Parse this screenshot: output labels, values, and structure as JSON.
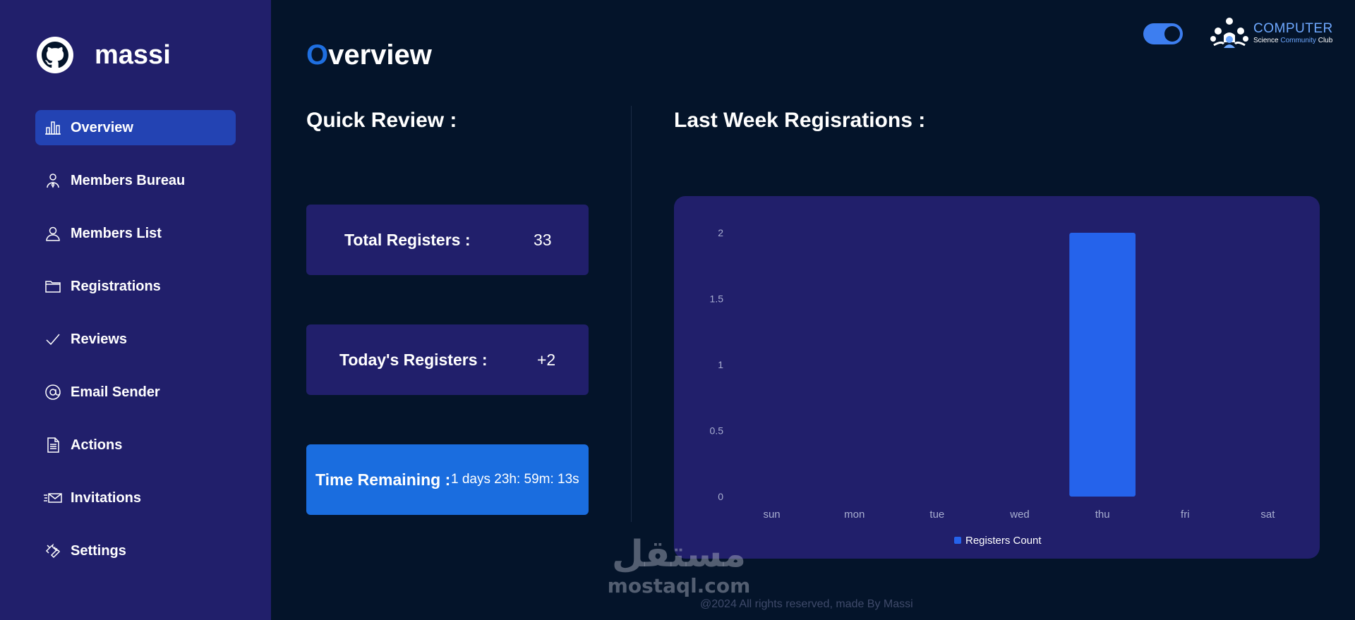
{
  "brand": {
    "name": "massi",
    "icon": "github-icon"
  },
  "sidebar": {
    "items": [
      {
        "label": "Overview",
        "icon": "bar-chart-icon",
        "active": true
      },
      {
        "label": "Members Bureau",
        "icon": "user-tie-icon"
      },
      {
        "label": "Members List",
        "icon": "user-icon"
      },
      {
        "label": "Registrations",
        "icon": "folder-icon"
      },
      {
        "label": "Reviews",
        "icon": "check-icon"
      },
      {
        "label": "Email Sender",
        "icon": "at-icon"
      },
      {
        "label": "Actions",
        "icon": "document-icon"
      },
      {
        "label": "Invitations",
        "icon": "envelope-icon"
      },
      {
        "label": "Settings",
        "icon": "wrench-icon"
      }
    ]
  },
  "header": {
    "title_first": "O",
    "title_rest": "verview",
    "theme_toggle_on": true,
    "club": {
      "top": "COMPUTER",
      "bottom_1": "Science",
      "bottom_2": "Community",
      "bottom_3": "Club"
    }
  },
  "quick_review": {
    "title": "Quick Review :",
    "total": {
      "label": "Total Registers :",
      "value": "33"
    },
    "today": {
      "label": "Today's Registers :",
      "value": "+2"
    },
    "timer": {
      "label": "Time Remaining :",
      "value": "1 days 23h: 59m: 13s"
    }
  },
  "last_week": {
    "title": "Last Week Regisrations :"
  },
  "chart_data": {
    "type": "bar",
    "categories": [
      "sun",
      "mon",
      "tue",
      "wed",
      "thu",
      "fri",
      "sat"
    ],
    "series": [
      {
        "name": "Registers Count",
        "values": [
          0,
          0,
          0,
          0,
          2,
          0,
          0
        ]
      }
    ],
    "yticks": [
      "0",
      "0.5",
      "1",
      "1.5",
      "2"
    ],
    "ylim": [
      0,
      2
    ],
    "legend_position": "bottom",
    "bar_color": "#2563eb"
  },
  "footer": {
    "text": "@2024 All rights reserved, made By Massi"
  },
  "watermark": {
    "arabic": "مستقل",
    "latin": "mostaql.com"
  },
  "colors": {
    "sidebar": "#211f6b",
    "background": "#04142a",
    "accent": "#1f6fe0",
    "active_nav": "#2343b3"
  }
}
